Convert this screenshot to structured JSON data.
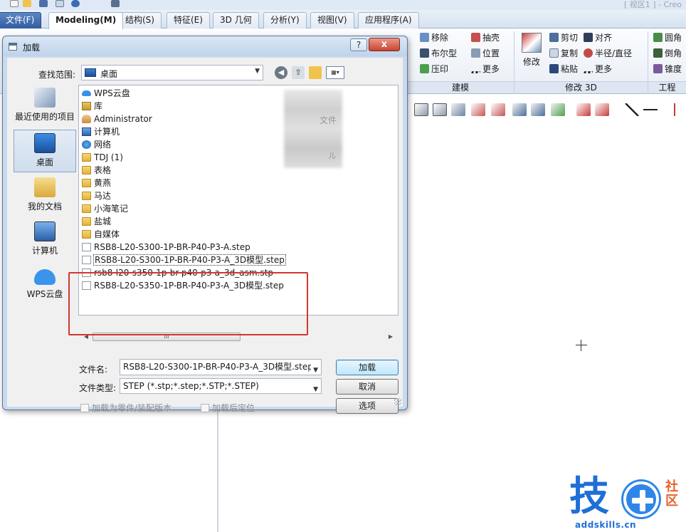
{
  "window": {
    "title": "[ 视区1 ] - Creo",
    "file_tab": "文件(F)",
    "tabs": [
      "Modeling(M)",
      "结构(S)",
      "特征(E)",
      "3D 几何",
      "分析(Y)",
      "视图(V)",
      "应用程序(A)"
    ]
  },
  "ribbon": {
    "build_items": [
      "移除",
      "布尔型",
      "压印"
    ],
    "build_items2": [
      "抽壳",
      "位置",
      "更多"
    ],
    "modify_big": "修改",
    "modify_items": [
      "剪切",
      "复制",
      "粘贴"
    ],
    "modify_items2": [
      "对齐",
      "半径/直径",
      "更多"
    ],
    "eng_items": [
      "圆角",
      "倒角",
      "锥度"
    ],
    "group_labels": [
      "建模",
      "修改 3D",
      "工程"
    ]
  },
  "dialog": {
    "title": "加载",
    "help_label": "?",
    "close_label": "x",
    "look_in_label": "查找范围:",
    "look_in_value": "桌面",
    "places": [
      {
        "label": "最近使用的项目",
        "icon": "recent-places-icon"
      },
      {
        "label": "桌面",
        "icon": "desktop-icon"
      },
      {
        "label": "我的文档",
        "icon": "documents-icon"
      },
      {
        "label": "计算机",
        "icon": "computer-icon"
      },
      {
        "label": "WPS云盘",
        "icon": "wps-cloud-icon"
      }
    ],
    "items": [
      {
        "name": "WPS云盘",
        "icon": "cloud-icon"
      },
      {
        "name": "库",
        "icon": "library-icon"
      },
      {
        "name": "Administrator",
        "icon": "user-folder-icon"
      },
      {
        "name": "计算机",
        "icon": "computer-icon"
      },
      {
        "name": "网络",
        "icon": "network-icon"
      },
      {
        "name": "TDJ (1)",
        "icon": "folder-icon"
      },
      {
        "name": "表格",
        "icon": "folder-icon"
      },
      {
        "name": "黄燕",
        "icon": "folder-icon"
      },
      {
        "name": "马达",
        "icon": "folder-icon"
      },
      {
        "name": "小海笔记",
        "icon": "folder-icon"
      },
      {
        "name": "盐城",
        "icon": "folder-icon"
      },
      {
        "name": "自媒体",
        "icon": "folder-icon"
      },
      {
        "name": "RSB8-L20-S300-1P-BR-P40-P3-A.step",
        "icon": "file-icon"
      },
      {
        "name": "RSB8-L20-S300-1P-BR-P40-P3-A_3D模型.step",
        "icon": "file-icon"
      },
      {
        "name": "rsb8-l20-s350-1p-br-p40-p3-a_3d_asm.stp",
        "icon": "locked-file-icon"
      },
      {
        "name": "RSB8-L20-S350-1P-BR-P40-P3-A_3D模型.step",
        "icon": "file-icon"
      }
    ],
    "blurred_partial_text": [
      "文件",
      "ル"
    ],
    "file_name_label": "文件名:",
    "file_name_value": "RSB8-L20-S300-1P-BR-P40-P3-A_3D模型.step",
    "file_type_label": "文件类型:",
    "file_type_value": "STEP (*.stp;*.step;*.STP;*.STEP)",
    "load_button": "加载",
    "cancel_button": "取消",
    "options_button": "选项",
    "check_as_part": "加载为零件/装配版本",
    "check_relocate": "加载后定位",
    "scroll_thumb": "III"
  },
  "watermark": {
    "char": "技",
    "tag_line1": "社",
    "tag_line2": "区",
    "url": "addskills.cn"
  },
  "colors": {
    "highlight_box": "#d0372d",
    "watermark_blue": "#1e6fd6",
    "watermark_orange": "#e8612a"
  }
}
